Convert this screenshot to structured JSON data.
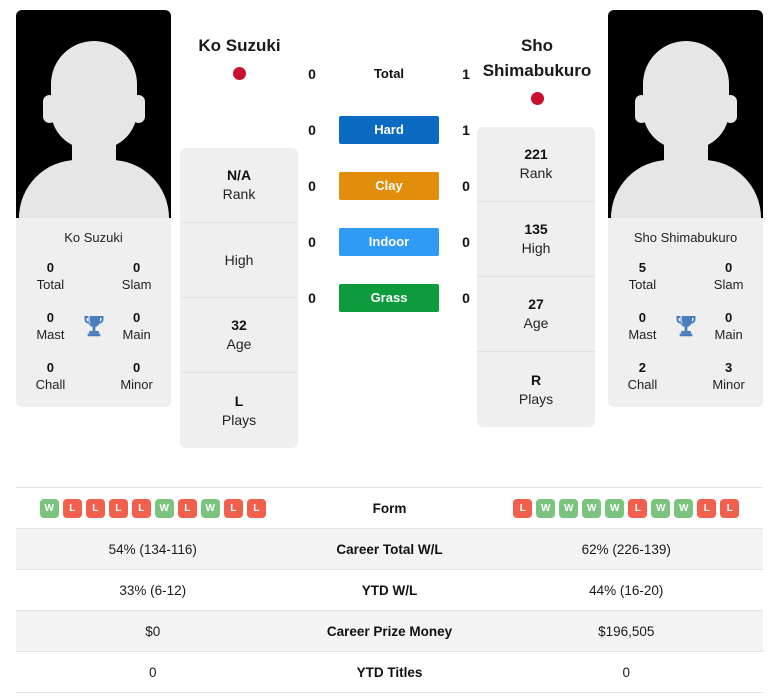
{
  "players": {
    "left": {
      "name": "Ko Suzuki",
      "card_name": "Ko Suzuki",
      "flag": "japan-flag-dot",
      "flag_color": "#c8102e",
      "info": [
        {
          "value": "N/A",
          "label": "Rank"
        },
        {
          "value": "",
          "label": "High"
        },
        {
          "value": "32",
          "label": "Age"
        },
        {
          "value": "L",
          "label": "Plays"
        }
      ],
      "titles": [
        {
          "value": "0",
          "label": "Total"
        },
        {
          "value": "0",
          "label": "Slam"
        },
        {
          "value": "0",
          "label": "Mast"
        },
        {
          "value": "0",
          "label": "Main"
        },
        {
          "value": "0",
          "label": "Chall"
        },
        {
          "value": "0",
          "label": "Minor"
        }
      ],
      "form": [
        "W",
        "L",
        "L",
        "L",
        "L",
        "W",
        "L",
        "W",
        "L",
        "L"
      ],
      "career_total_wl": "54% (134-116)",
      "ytd_wl": "33% (6-12)",
      "career_prize_money": "$0",
      "ytd_titles": "0"
    },
    "right": {
      "name": "Sho Shimabukuro",
      "name_line1": "Sho",
      "name_line2": "Shimabukuro",
      "card_name": "Sho Shimabukuro",
      "flag": "japan-flag-dot",
      "flag_color": "#c8102e",
      "info": [
        {
          "value": "221",
          "label": "Rank"
        },
        {
          "value": "135",
          "label": "High"
        },
        {
          "value": "27",
          "label": "Age"
        },
        {
          "value": "R",
          "label": "Plays"
        }
      ],
      "titles": [
        {
          "value": "5",
          "label": "Total"
        },
        {
          "value": "0",
          "label": "Slam"
        },
        {
          "value": "0",
          "label": "Mast"
        },
        {
          "value": "0",
          "label": "Main"
        },
        {
          "value": "2",
          "label": "Chall"
        },
        {
          "value": "3",
          "label": "Minor"
        }
      ],
      "form": [
        "L",
        "W",
        "W",
        "W",
        "W",
        "L",
        "W",
        "W",
        "L",
        "L"
      ],
      "career_total_wl": "62% (226-139)",
      "ytd_wl": "44% (16-20)",
      "career_prize_money": "$196,505",
      "ytd_titles": "0"
    }
  },
  "head_to_head": [
    {
      "label": "Total",
      "left": "0",
      "right": "1",
      "style": "plain",
      "color": ""
    },
    {
      "label": "Hard",
      "left": "0",
      "right": "1",
      "style": "chip",
      "color": "#0b6bc3"
    },
    {
      "label": "Clay",
      "left": "0",
      "right": "0",
      "style": "chip",
      "color": "#e08e0b"
    },
    {
      "label": "Indoor",
      "left": "0",
      "right": "0",
      "style": "chip",
      "color": "#2f9bf5"
    },
    {
      "label": "Grass",
      "left": "0",
      "right": "0",
      "style": "chip",
      "color": "#0e9b3e"
    }
  ],
  "table_rows": [
    {
      "label": "Form",
      "type": "form",
      "left": "",
      "right": "",
      "alt": false
    },
    {
      "label": "Career Total W/L",
      "type": "text",
      "left": "54% (134-116)",
      "right": "62% (226-139)",
      "alt": true
    },
    {
      "label": "YTD W/L",
      "type": "text",
      "left": "33% (6-12)",
      "right": "44% (16-20)",
      "alt": false
    },
    {
      "label": "Career Prize Money",
      "type": "text",
      "left": "$0",
      "right": "$196,505",
      "alt": true
    },
    {
      "label": "YTD Titles",
      "type": "text",
      "left": "0",
      "right": "0",
      "alt": false
    }
  ],
  "icons": {
    "trophy": "trophy-icon",
    "avatar": "player-avatar-placeholder"
  }
}
